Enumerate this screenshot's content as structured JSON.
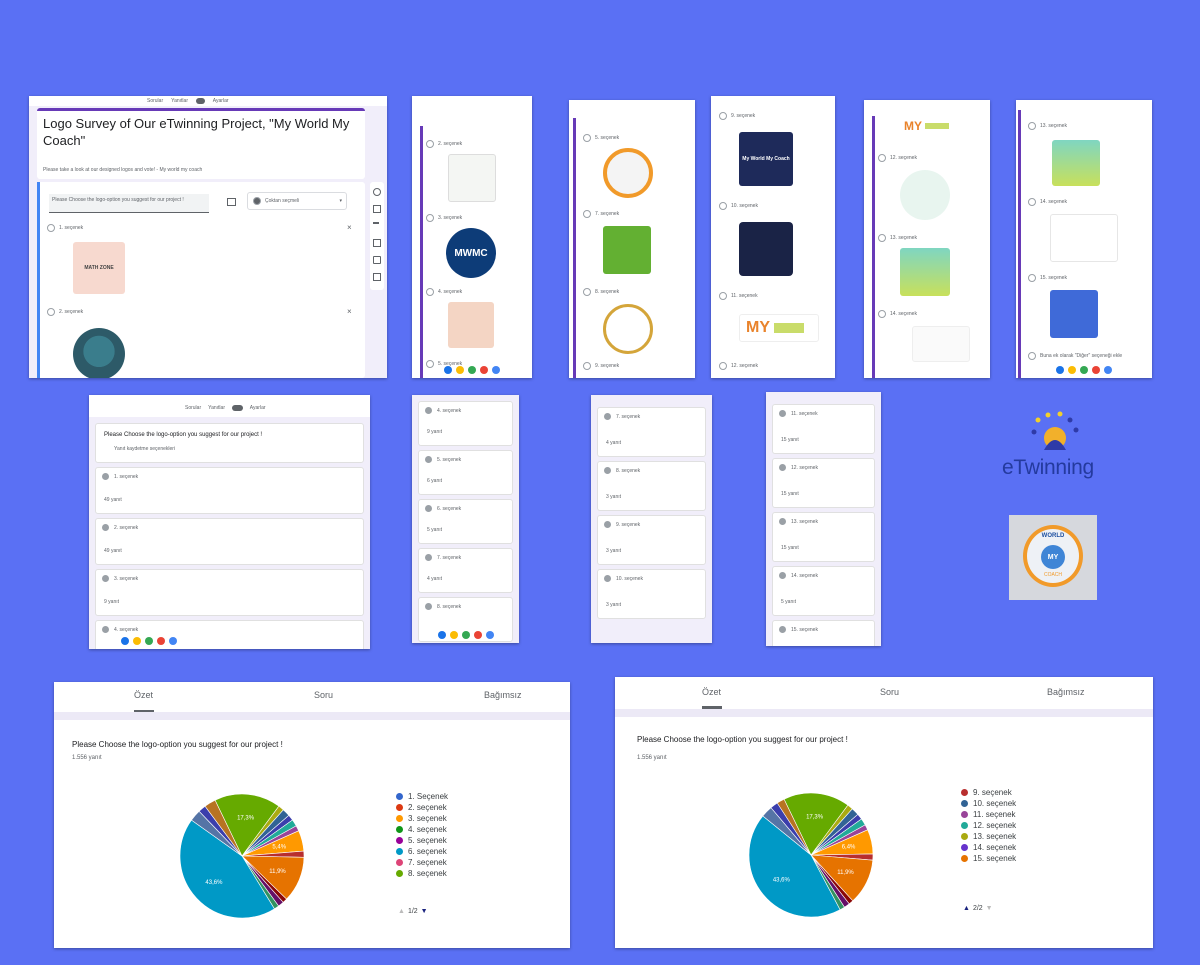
{
  "editor": {
    "tabs": [
      "Sorular",
      "Yanıtlar",
      "Ayarlar"
    ],
    "title": "Logo Survey of Our eTwinning Project, \"My World My Coach\"",
    "description": "Please take a look at our designed logos and vote! - My world my coach",
    "question": "Please Choose the logo-option you suggest for our project !",
    "type_label": "Çoktan seçmeli",
    "options": [
      "1. seçenek",
      "2. seçenek"
    ],
    "logo_texts": [
      "MATH ZONE"
    ]
  },
  "strip1": {
    "options": [
      "2. seçenek",
      "3. seçenek",
      "4. seçenek",
      "5. seçenek"
    ],
    "logo_text": "MWMC"
  },
  "strip2": {
    "options": [
      "5. seçenek",
      "7. seçenek",
      "8. seçenek",
      "9. seçenek"
    ]
  },
  "strip3": {
    "options": [
      "9. seçenek",
      "10. seçenek",
      "11. seçenek",
      "12. seçenek"
    ],
    "logo_texts": [
      "My World My Coach",
      "MY"
    ]
  },
  "strip4": {
    "options": [
      "12. seçenek",
      "13. seçenek",
      "14. seçenek"
    ],
    "logo_text": "MY"
  },
  "strip5": {
    "options": [
      "13. seçenek",
      "14. seçenek",
      "15. seçenek",
      "Buna ek olarak \"Diğer\" seçeneği ekle"
    ]
  },
  "preview": {
    "tabs": [
      "Sorular",
      "Yanıtlar",
      "Ayarlar"
    ],
    "question": "Please Choose the logo-option you suggest for our project !",
    "subtitle": "Yanıt kaydetme seçenekleri",
    "rows": [
      {
        "label": "1. seçenek",
        "count": "49 yanıt"
      },
      {
        "label": "2. seçenek",
        "count": "49 yanıt"
      },
      {
        "label": "3. seçenek",
        "count": "9 yanıt"
      },
      {
        "label": "4. seçenek",
        "count": ""
      }
    ]
  },
  "list1": {
    "rows": [
      {
        "label": "4. seçenek",
        "count": "9 yanıt"
      },
      {
        "label": "5. seçenek",
        "count": "6 yanıt"
      },
      {
        "label": "6. seçenek",
        "count": "5 yanıt"
      },
      {
        "label": "7. seçenek",
        "count": "4 yanıt"
      },
      {
        "label": "8. seçenek",
        "count": ""
      }
    ]
  },
  "list2": {
    "rows": [
      {
        "label": "7. seçenek",
        "count": "4 yanıt"
      },
      {
        "label": "8. seçenek",
        "count": "3 yanıt"
      },
      {
        "label": "9. seçenek",
        "count": "3 yanıt"
      },
      {
        "label": "10. seçenek",
        "count": "3 yanıt"
      }
    ]
  },
  "list3": {
    "rows": [
      {
        "label": "11. seçenek",
        "count": "15 yanıt"
      },
      {
        "label": "12. seçenek",
        "count": "15 yanıt"
      },
      {
        "label": "13. seçenek",
        "count": "15 yanıt"
      },
      {
        "label": "14. seçenek",
        "count": "5 yanıt"
      },
      {
        "label": "15. seçenek",
        "count": ""
      }
    ]
  },
  "etwinning": {
    "text": "eTwinning"
  },
  "mwmc_logo": {
    "top": "WORLD",
    "center": "MY",
    "bottom": "COACH"
  },
  "results_left": {
    "tabs": [
      "Özet",
      "Soru",
      "Bağımsız"
    ],
    "question": "Please Choose the logo-option you suggest for our project !",
    "count": "1.556 yanıt",
    "pager": "1/2",
    "pie_labels": [
      "17,3%",
      "43,6%",
      "11,9%",
      "5,4%"
    ]
  },
  "results_right": {
    "tabs": [
      "Özet",
      "Soru",
      "Bağımsız"
    ],
    "question": "Please Choose the logo-option you suggest for our project !",
    "count": "1.556 yanıt",
    "pager": "2/2",
    "pie_labels": [
      "17,3%",
      "43,6%",
      "11,9%",
      "6,4%"
    ]
  },
  "chart_data": [
    {
      "type": "pie",
      "title": "Please Choose the logo-option you suggest for our project !",
      "categories": [
        "1. Seçenek",
        "2. seçenek",
        "3. seçenek",
        "4. seçenek",
        "5. seçenek",
        "6. seçenek",
        "7. seçenek",
        "8. seçenek"
      ],
      "legend_colors": [
        "#3366cc",
        "#dc3912",
        "#ff9900",
        "#109618",
        "#990099",
        "#0099c6",
        "#dd4477",
        "#66aa00"
      ],
      "slices": [
        {
          "color": "#66aa00",
          "value": 17.3
        },
        {
          "color": "#aaaa11",
          "value": 1.5
        },
        {
          "color": "#316395",
          "value": 2.0
        },
        {
          "color": "#3b3eac",
          "value": 1.5
        },
        {
          "color": "#22aa99",
          "value": 1.8
        },
        {
          "color": "#994499",
          "value": 1.4
        },
        {
          "color": "#ff9900",
          "value": 5.4
        },
        {
          "color": "#b82e2e",
          "value": 1.6
        },
        {
          "color": "#e67300",
          "value": 11.9
        },
        {
          "color": "#8b0707",
          "value": 1.2
        },
        {
          "color": "#651067",
          "value": 1.5
        },
        {
          "color": "#329262",
          "value": 1.3
        },
        {
          "color": "#0099c6",
          "value": 43.6
        },
        {
          "color": "#5574a6",
          "value": 3.0
        },
        {
          "color": "#3b3eac",
          "value": 2.0
        },
        {
          "color": "#b77322",
          "value": 3.0
        }
      ],
      "legend": "right"
    },
    {
      "type": "pie",
      "title": "Please Choose the logo-option you suggest for our project !",
      "categories": [
        "9. seçenek",
        "10. seçenek",
        "11. seçenek",
        "12. seçenek",
        "13. seçenek",
        "14. seçenek",
        "15. seçenek"
      ],
      "legend_colors": [
        "#b82e2e",
        "#316395",
        "#994499",
        "#22aa99",
        "#aaaa11",
        "#6633cc",
        "#e67300"
      ],
      "slices": [
        {
          "color": "#66aa00",
          "value": 17.3
        },
        {
          "color": "#aaaa11",
          "value": 1.5
        },
        {
          "color": "#316395",
          "value": 2.0
        },
        {
          "color": "#3b3eac",
          "value": 1.5
        },
        {
          "color": "#22aa99",
          "value": 1.8
        },
        {
          "color": "#994499",
          "value": 1.4
        },
        {
          "color": "#ff9900",
          "value": 6.4
        },
        {
          "color": "#b82e2e",
          "value": 1.6
        },
        {
          "color": "#e67300",
          "value": 11.9
        },
        {
          "color": "#8b0707",
          "value": 1.2
        },
        {
          "color": "#651067",
          "value": 1.5
        },
        {
          "color": "#329262",
          "value": 1.3
        },
        {
          "color": "#0099c6",
          "value": 43.6
        },
        {
          "color": "#5574a6",
          "value": 3.0
        },
        {
          "color": "#3b3eac",
          "value": 2.0
        },
        {
          "color": "#b77322",
          "value": 2.0
        }
      ],
      "legend": "right"
    }
  ]
}
